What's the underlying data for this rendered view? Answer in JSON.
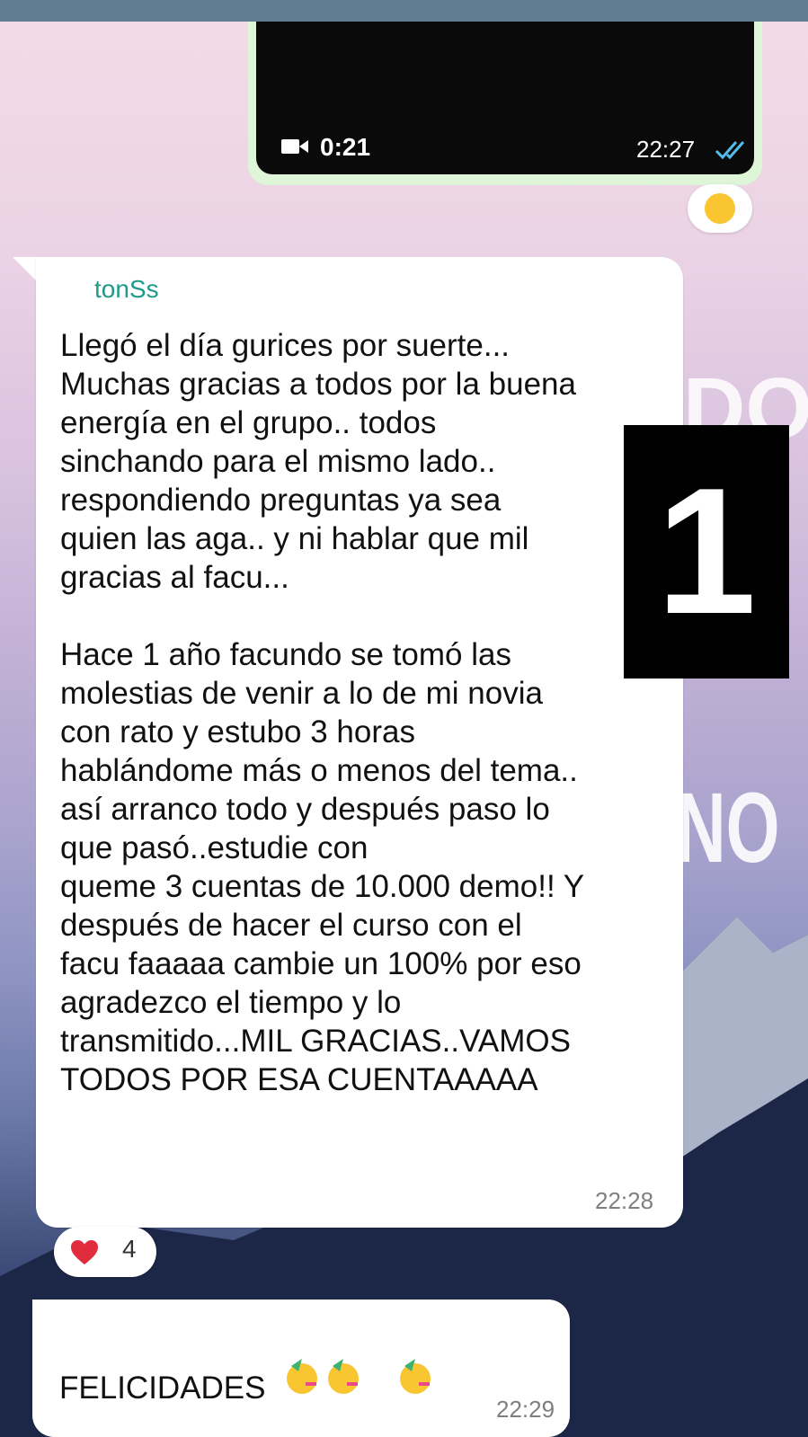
{
  "video_message": {
    "duration": "0:21",
    "time": "22:27",
    "status": "read",
    "reaction_emoji": "partying-face"
  },
  "message_1": {
    "sender": "tonSs",
    "text": "Llegó el día gurices por suerte...\nMuchas gracias a todos por la buena\nenergía en el grupo.. todos\nsinchando para el mismo lado..\nrespondiendo preguntas ya sea\nquien las aga.. y ni hablar que mil\ngracias al facu...\n\nHace 1 año facundo se tomó las\nmolestias de venir a lo de mi novia\ncon rato y estubo 3 horas\nhablándome más o menos del tema..\nasí arranco todo y después paso lo\nque pasó..estudie con\nqueme 3 cuentas de 10.000 demo!! Y\ndespués de hacer el curso con el\nfacu faaaaa cambie un 100% por eso\nagradezco el tiempo y lo\ntransmitido...MIL GRACIAS..VAMOS\nTODOS POR ESA CUENTAAAAA",
    "time": "22:28",
    "reaction": {
      "emoji": "red-heart",
      "count": "4"
    }
  },
  "overlay_label": "1",
  "message_2": {
    "text": "FELICIDADES",
    "emojis": [
      "partying-face",
      "partying-face",
      "partying-face"
    ],
    "time": "22:29"
  },
  "colors": {
    "status_bar": "#5f7f90",
    "video_bubble": "#dff5d8",
    "sender_name": "#1f9a8a",
    "read_ticks": "#53bdeb"
  }
}
